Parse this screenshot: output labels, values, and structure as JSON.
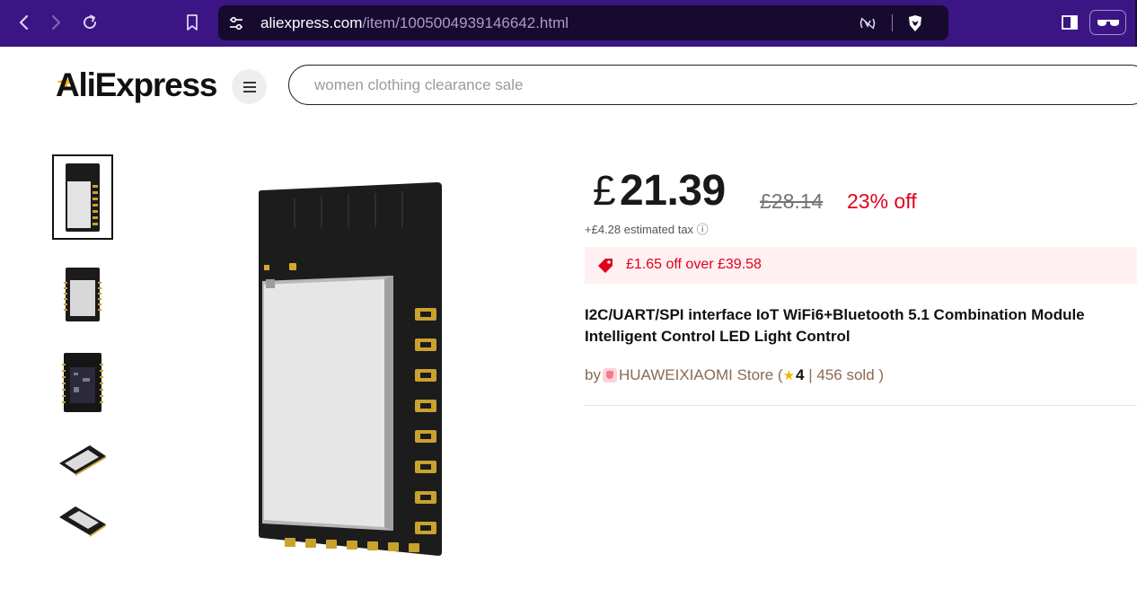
{
  "browser": {
    "url_domain": "aliexpress.com",
    "url_path": "/item/1005004939146642.html",
    "icons": [
      "back-icon",
      "forward-icon",
      "reload-icon",
      "bookmark-icon",
      "site-settings-icon",
      "reader-mode-icon",
      "brave-shield-icon",
      "sidebar-icon",
      "glasses-icon"
    ]
  },
  "header": {
    "logo_text": "AliExpress",
    "search_placeholder": "women clothing clearance sale"
  },
  "product": {
    "currency_symbol": "£",
    "price": "21.39",
    "original_price": "£28.14",
    "discount": "23% off",
    "tax_note": "+£4.28 estimated tax ⓘ",
    "coupon": "£1.65 off over £39.58",
    "title_line1": "I2C/UART/SPI interface IoT WiFi6+Bluetooth 5.1 Combination Module",
    "title_line2": "Intelligent Control LED Light Control",
    "store_prefix": "by",
    "store_name": "HUAWEIXIAOMI Store",
    "rating": "4",
    "sold": "456 sold"
  },
  "thumbnails": [
    {
      "name": "thumbnail-1",
      "active": true
    },
    {
      "name": "thumbnail-2",
      "active": false
    },
    {
      "name": "thumbnail-3",
      "active": false
    },
    {
      "name": "thumbnail-4",
      "active": false
    },
    {
      "name": "thumbnail-5",
      "active": false
    }
  ],
  "colors": {
    "browser_bar": "#3b1583",
    "price_text": "#191919",
    "discount_red": "#e1001c",
    "coupon_bg": "#fff0f1",
    "store_text": "#8a6a52"
  }
}
